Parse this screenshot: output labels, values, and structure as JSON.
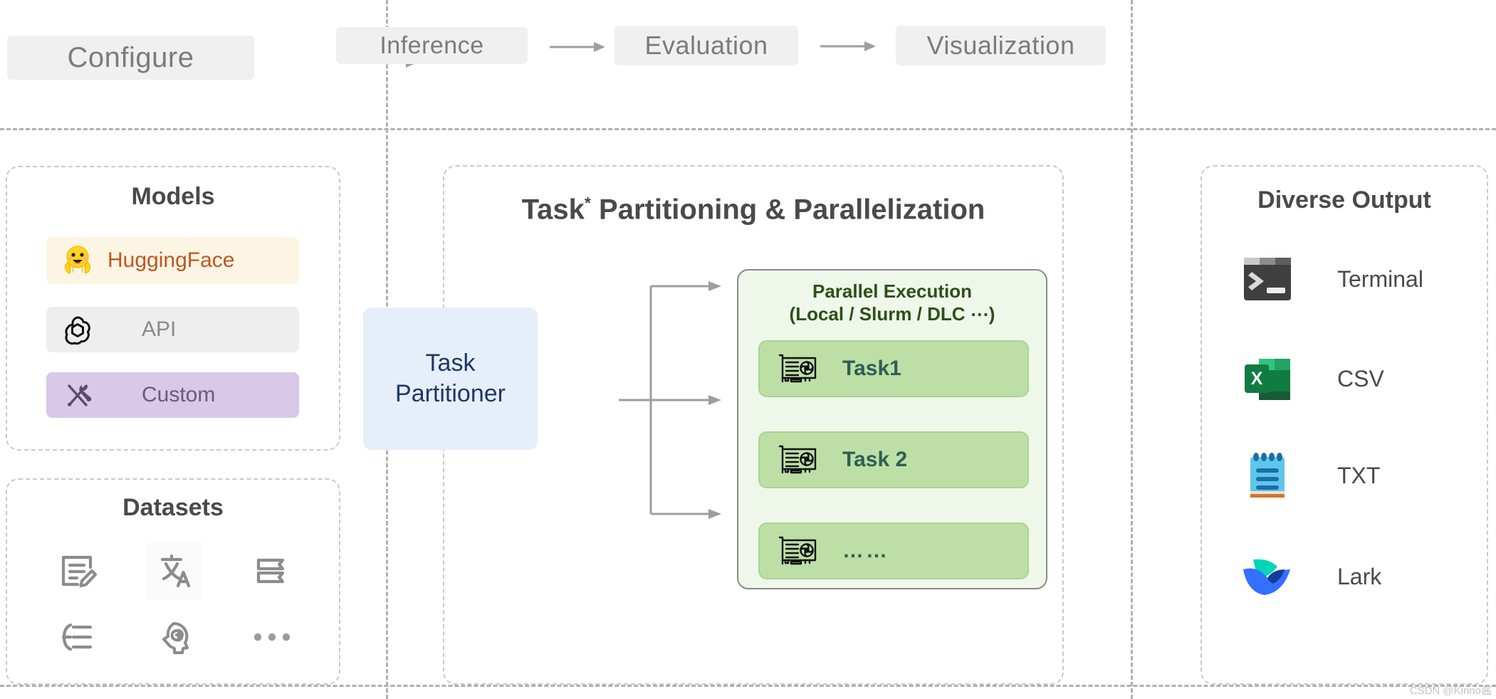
{
  "pipeline": {
    "stages": [
      {
        "label": "Configure",
        "icon": "stage-pill"
      },
      {
        "label": "Inference",
        "icon": "stage-pill"
      },
      {
        "label": "Evaluation",
        "icon": "stage-pill"
      },
      {
        "label": "Visualization",
        "icon": "stage-pill"
      }
    ],
    "arrow_icon": "arrow-right-icon"
  },
  "models": {
    "title": "Models",
    "items": [
      {
        "label": "HuggingFace",
        "icon": "hugging-face-icon",
        "bg": "#fdf5e3",
        "text_color": "#c05621"
      },
      {
        "label": "API",
        "icon": "openai-icon",
        "bg": "#eeeeee",
        "text_color": "#8a8a8a"
      },
      {
        "label": "Custom",
        "icon": "tools-icon",
        "bg": "#d9c8e8",
        "text_color": "#6b5b7b"
      }
    ]
  },
  "datasets": {
    "title": "Datasets",
    "icons": [
      "document-edit-icon",
      "translate-icon",
      "book-icon",
      "list-brace-icon",
      "brain-head-icon",
      "ellipsis-icon"
    ]
  },
  "center": {
    "title_main": "Task",
    "title_sup": "*",
    "title_rest": " Partitioning & Parallelization",
    "partitioner": {
      "line1": "Task",
      "line2": "Partitioner"
    },
    "parallel_execution": {
      "title_line1": "Parallel Execution",
      "title_line2": "(Local / Slurm / DLC ⋯)",
      "tasks": [
        {
          "label": "Task1",
          "icon": "gpu-card-icon"
        },
        {
          "label": "Task 2",
          "icon": "gpu-card-icon"
        },
        {
          "label": "……",
          "icon": "gpu-card-icon"
        }
      ]
    },
    "flow_arrow_icon": "branch-arrow-icon"
  },
  "output": {
    "title": "Diverse Output",
    "items": [
      {
        "label": "Terminal",
        "icon": "terminal-icon"
      },
      {
        "label": "CSV",
        "icon": "excel-icon"
      },
      {
        "label": "TXT",
        "icon": "notepad-icon"
      },
      {
        "label": "Lark",
        "icon": "lark-icon"
      }
    ]
  },
  "watermark": {
    "text": "CSDN @Kinno酱"
  },
  "colors": {
    "divider": "#b0b0b0",
    "pill_bg": "#f0f0f0",
    "pill_text": "#7b7b7b",
    "panel_border": "#c9c9c9",
    "partitioner_bg": "#e6eef9",
    "partitioner_text": "#1f3864",
    "pexec_bg": "#eef7ea",
    "pexec_text": "#2d5016",
    "task_bg": "#bddfa6",
    "task_text": "#2f5d55"
  }
}
